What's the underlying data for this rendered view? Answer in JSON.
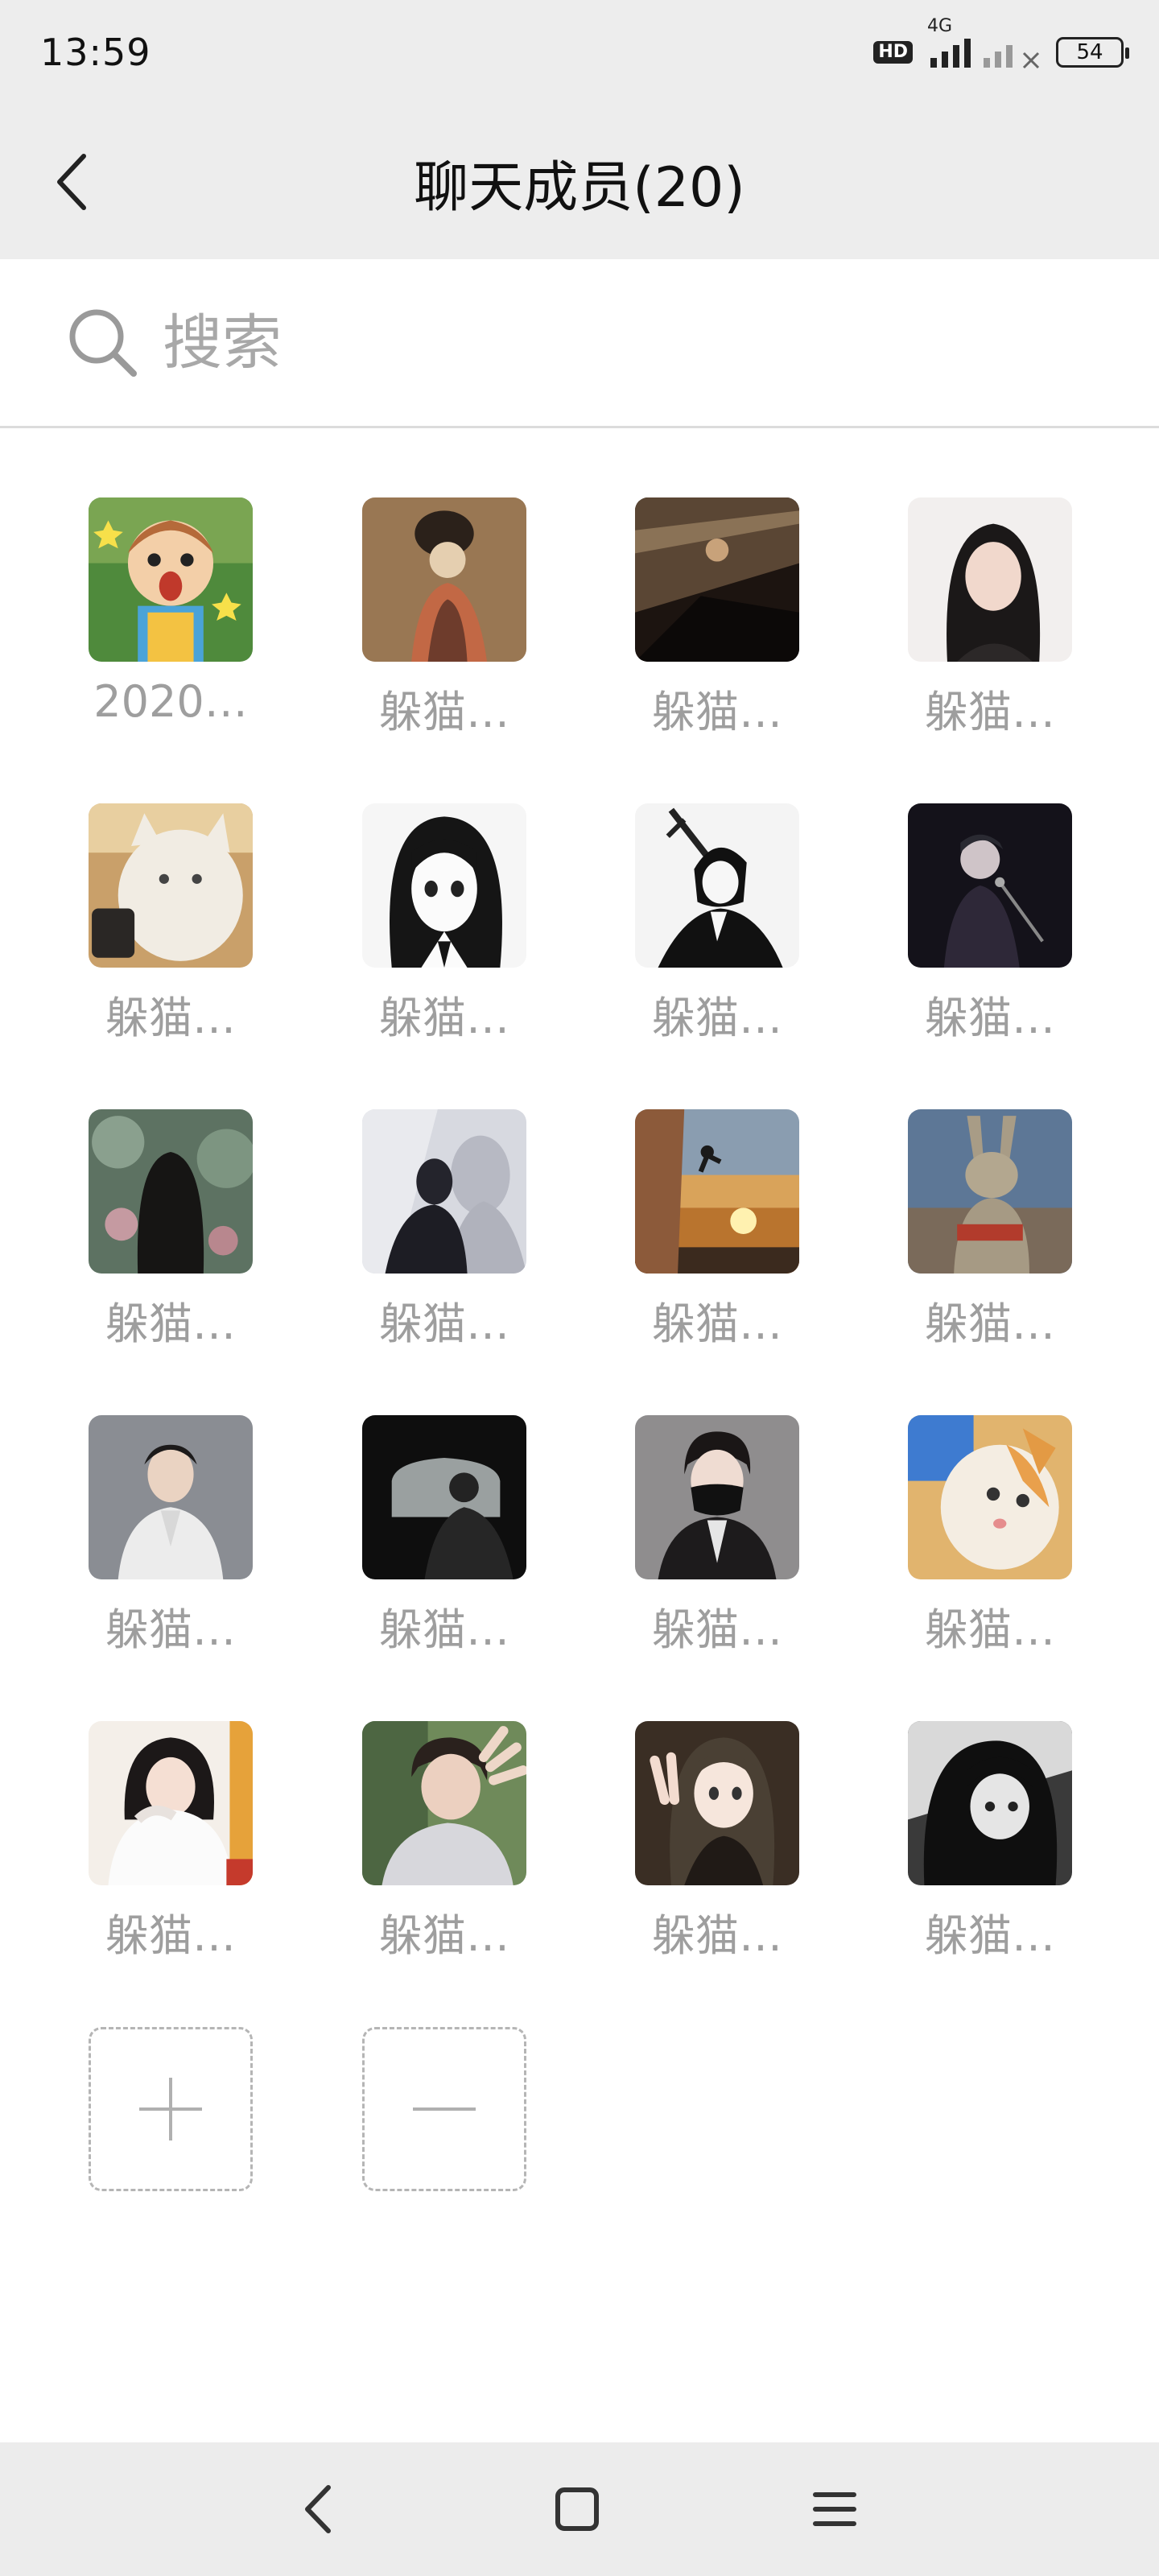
{
  "status_bar": {
    "time": "13:59",
    "hd_label": "HD",
    "network_label": "4G",
    "battery_level": "54"
  },
  "header": {
    "title": "聊天成员(20)"
  },
  "search": {
    "placeholder": "搜索",
    "value": ""
  },
  "members": [
    {
      "name": "2020…",
      "avatar": "cartoon-boy"
    },
    {
      "name": "躲猫…",
      "avatar": "painting-lady"
    },
    {
      "name": "躲猫…",
      "avatar": "dark-scene"
    },
    {
      "name": "躲猫…",
      "avatar": "girl-portrait"
    },
    {
      "name": "躲猫…",
      "avatar": "white-cat"
    },
    {
      "name": "躲猫…",
      "avatar": "manga-girl"
    },
    {
      "name": "躲猫…",
      "avatar": "manga-swordsman"
    },
    {
      "name": "躲猫…",
      "avatar": "stage-singer"
    },
    {
      "name": "躲猫…",
      "avatar": "girl-garden"
    },
    {
      "name": "躲猫…",
      "avatar": "silhouette-shadow"
    },
    {
      "name": "躲猫…",
      "avatar": "sunset-climber"
    },
    {
      "name": "躲猫…",
      "avatar": "rabbit-costume"
    },
    {
      "name": "躲猫…",
      "avatar": "man-white-suit"
    },
    {
      "name": "躲猫…",
      "avatar": "car-window"
    },
    {
      "name": "躲猫…",
      "avatar": "masked-boy"
    },
    {
      "name": "躲猫…",
      "avatar": "cat-closeup"
    },
    {
      "name": "躲猫…",
      "avatar": "woman-white-sweater"
    },
    {
      "name": "躲猫…",
      "avatar": "boy-hand"
    },
    {
      "name": "躲猫…",
      "avatar": "girl-peace-sign"
    },
    {
      "name": "躲猫…",
      "avatar": "anime-dark-hair"
    }
  ],
  "actions": {
    "add_icon": "plus-icon",
    "remove_icon": "minus-icon"
  },
  "colors": {
    "header_bg": "#ededed",
    "name_text": "#9e9e9e",
    "dashed_border": "#b5b5b5"
  }
}
